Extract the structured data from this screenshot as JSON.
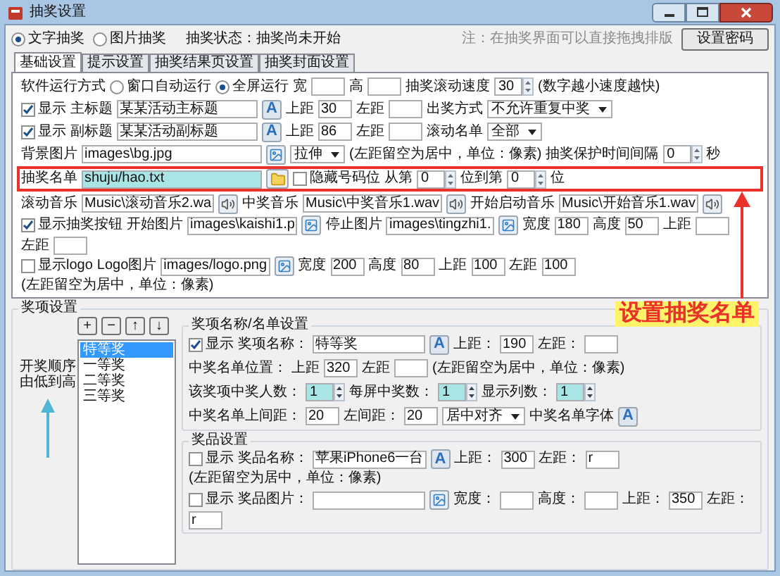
{
  "window": {
    "title": "抽奖设置"
  },
  "top": {
    "radios": [
      {
        "label": "文字抽奖",
        "selected": true
      },
      {
        "label": "图片抽奖",
        "selected": false
      }
    ],
    "status": "抽奖状态：抽奖尚未开始",
    "note": "注：在抽奖界面可以直接拖拽排版",
    "password_button": "设置密码"
  },
  "tabs": [
    {
      "label": "基础设置",
      "selected": true
    },
    {
      "label": "提示设置",
      "selected": false
    },
    {
      "label": "抽奖结果页设置",
      "selected": false
    },
    {
      "label": "抽奖封面设置",
      "selected": false
    }
  ],
  "basic": {
    "rows": [
      {
        "items": [
          {
            "kind": "label",
            "text": "软件运行方式"
          },
          {
            "kind": "radio",
            "label": "窗口自动运行",
            "selected": false
          },
          {
            "kind": "radio",
            "label": "全屏运行",
            "selected": true
          },
          {
            "kind": "label",
            "text": "宽"
          },
          {
            "kind": "field"
          },
          {
            "kind": "label",
            "text": "高"
          },
          {
            "kind": "field"
          },
          {
            "kind": "label",
            "text": "抽奖滚动速度"
          },
          {
            "kind": "spin",
            "value": "30"
          },
          {
            "kind": "note",
            "text": "(数字越小速度越快)"
          }
        ]
      },
      {
        "items": [
          {
            "kind": "checkbox",
            "label": "显示",
            "checked": true
          },
          {
            "kind": "label",
            "text": "主标题"
          },
          {
            "kind": "name_field",
            "value": "某某活动主标题"
          },
          {
            "kind": "font_button",
            "text": "A"
          },
          {
            "kind": "label",
            "text": "上距"
          },
          {
            "kind": "field",
            "value": "30"
          },
          {
            "kind": "label",
            "text": "左距"
          },
          {
            "kind": "field"
          },
          {
            "kind": "label",
            "text": "出奖方式"
          },
          {
            "kind": "select",
            "value": "不允许重复中奖"
          }
        ]
      },
      {
        "items": [
          {
            "kind": "checkbox",
            "label": "显示",
            "checked": true
          },
          {
            "kind": "label",
            "text": "副标题"
          },
          {
            "kind": "name_field",
            "value": "某某活动副标题"
          },
          {
            "kind": "font_button",
            "text": "A"
          },
          {
            "kind": "label",
            "text": "上距"
          },
          {
            "kind": "field",
            "value": "86"
          },
          {
            "kind": "label",
            "text": "左距"
          },
          {
            "kind": "field"
          },
          {
            "kind": "label",
            "text": "滚动名单"
          },
          {
            "kind": "select",
            "value": "全部"
          }
        ]
      },
      {
        "items": [
          {
            "kind": "label",
            "text": "背景图片"
          },
          {
            "kind": "long_field",
            "value": "images\\bg.jpg"
          },
          {
            "kind": "image_button"
          },
          {
            "kind": "select",
            "value": "拉伸"
          },
          {
            "kind": "note",
            "text": "(左距留空为居中，单位：像素)"
          },
          {
            "kind": "label",
            "text": "抽奖保护时间间隔"
          },
          {
            "kind": "spin",
            "value": "0"
          },
          {
            "kind": "label",
            "text": "秒"
          }
        ]
      },
      {
        "boxed": true,
        "items": [
          {
            "kind": "label",
            "text": "抽奖名单"
          },
          {
            "kind": "long_field",
            "value": "shuju/hao.txt",
            "highlighted": true
          },
          {
            "kind": "folder_button"
          },
          {
            "kind": "checkbox",
            "label": "隐藏号码位",
            "checked": false
          },
          {
            "kind": "label",
            "text": "从第"
          },
          {
            "kind": "spin",
            "value": "0"
          },
          {
            "kind": "label",
            "text": "位到第"
          },
          {
            "kind": "spin",
            "value": "0"
          },
          {
            "kind": "label",
            "text": "位"
          }
        ]
      },
      {
        "items": [
          {
            "kind": "label",
            "text": "滚动音乐"
          },
          {
            "kind": "path_field",
            "value": "Music\\滚动音乐2.wa"
          },
          {
            "kind": "speaker_button"
          },
          {
            "kind": "label",
            "text": "中奖音乐"
          },
          {
            "kind": "path_field",
            "value": "Music\\中奖音乐1.wav"
          },
          {
            "kind": "speaker_button"
          },
          {
            "kind": "label",
            "text": "开始启动音乐"
          },
          {
            "kind": "path_field",
            "value": "Music\\开始音乐1.wav"
          },
          {
            "kind": "speaker_button"
          }
        ]
      },
      {
        "items": [
          {
            "kind": "checkbox",
            "label": "显示抽奖按钮",
            "checked": true
          },
          {
            "kind": "label",
            "text": "开始图片"
          },
          {
            "kind": "path_field",
            "value": "images\\kaishi1.p"
          },
          {
            "kind": "image_button"
          },
          {
            "kind": "label",
            "text": "停止图片"
          },
          {
            "kind": "path_field",
            "value": "images\\tingzhi1."
          },
          {
            "kind": "image_button"
          },
          {
            "kind": "label",
            "text": "宽度"
          },
          {
            "kind": "field",
            "value": "180"
          },
          {
            "kind": "label",
            "text": "高度"
          },
          {
            "kind": "field",
            "value": "50"
          },
          {
            "kind": "label",
            "text": "上距"
          },
          {
            "kind": "field"
          },
          {
            "kind": "label",
            "text": "左距"
          },
          {
            "kind": "field"
          }
        ]
      },
      {
        "items": [
          {
            "kind": "checkbox",
            "label": "显示logo",
            "checked": false
          },
          {
            "kind": "label",
            "text": "Logo图片"
          },
          {
            "kind": "path_field",
            "value": "images/logo.png"
          },
          {
            "kind": "image_button"
          },
          {
            "kind": "label",
            "text": "宽度"
          },
          {
            "kind": "field",
            "value": "200"
          },
          {
            "kind": "label",
            "text": "高度"
          },
          {
            "kind": "field",
            "value": "80"
          },
          {
            "kind": "label",
            "text": "上距"
          },
          {
            "kind": "field",
            "value": "100"
          },
          {
            "kind": "label",
            "text": "左距"
          },
          {
            "kind": "field",
            "value": "100"
          },
          {
            "kind": "note",
            "text": "(左距留空为居中，单位：像素)"
          }
        ]
      }
    ]
  },
  "annotation": {
    "text": "设置抽奖名单"
  },
  "awards": {
    "title": "奖项设置",
    "buttons": [
      "+",
      "−",
      "↑",
      "↓"
    ],
    "order_label": "开奖顺序由低到高",
    "list": [
      {
        "label": "特等奖",
        "selected": true
      },
      {
        "label": "一等奖",
        "selected": false
      },
      {
        "label": "二等奖",
        "selected": false
      },
      {
        "label": "三等奖",
        "selected": false
      }
    ],
    "name_group": {
      "title": "奖项名称/名单设置",
      "rows": [
        {
          "items": [
            {
              "kind": "checkbox",
              "label": "显示",
              "checked": true
            },
            {
              "kind": "label",
              "text": "奖项名称："
            },
            {
              "kind": "text_field",
              "value": "特等奖"
            },
            {
              "kind": "font_button",
              "text": "A"
            },
            {
              "kind": "label",
              "text": "上距："
            },
            {
              "kind": "field",
              "value": "190"
            },
            {
              "kind": "label",
              "text": "左距："
            },
            {
              "kind": "field"
            }
          ]
        },
        {
          "items": [
            {
              "kind": "label",
              "text": "中奖名单位置："
            },
            {
              "kind": "label",
              "text": "上距"
            },
            {
              "kind": "field",
              "value": "320"
            },
            {
              "kind": "label",
              "text": "左距"
            },
            {
              "kind": "field"
            },
            {
              "kind": "note",
              "text": "(左距留空为居中，单位：像素)"
            }
          ]
        },
        {
          "items": [
            {
              "kind": "label",
              "text": "该奖项中奖人数："
            },
            {
              "kind": "spin",
              "value": "1",
              "highlighted": true
            },
            {
              "kind": "label",
              "text": "每屏中奖数："
            },
            {
              "kind": "spin",
              "value": "1",
              "highlighted": true
            },
            {
              "kind": "label",
              "text": "显示列数："
            },
            {
              "kind": "spin",
              "value": "1",
              "highlighted": true
            }
          ]
        },
        {
          "items": [
            {
              "kind": "label",
              "text": "中奖名单上间距："
            },
            {
              "kind": "field",
              "value": "20"
            },
            {
              "kind": "label",
              "text": "左间距："
            },
            {
              "kind": "field",
              "value": "20"
            },
            {
              "kind": "select",
              "value": "居中对齐"
            },
            {
              "kind": "label",
              "text": "中奖名单字体"
            },
            {
              "kind": "font_button",
              "text": "A"
            }
          ]
        }
      ]
    },
    "prize_group": {
      "title": "奖品设置",
      "rows": [
        {
          "items": [
            {
              "kind": "checkbox",
              "label": "显示",
              "checked": false
            },
            {
              "kind": "label",
              "text": "奖品名称："
            },
            {
              "kind": "text_field",
              "value": "苹果iPhone6一台"
            },
            {
              "kind": "font_button",
              "text": "A"
            },
            {
              "kind": "label",
              "text": "上距："
            },
            {
              "kind": "field",
              "value": "300"
            },
            {
              "kind": "label",
              "text": "左距："
            },
            {
              "kind": "field",
              "value": "r"
            },
            {
              "kind": "note",
              "text": "(左距留空为居中，单位：像素)"
            }
          ]
        },
        {
          "items": [
            {
              "kind": "checkbox",
              "label": "显示",
              "checked": false
            },
            {
              "kind": "label",
              "text": "奖品图片："
            },
            {
              "kind": "text_field"
            },
            {
              "kind": "image_button"
            },
            {
              "kind": "label",
              "text": "宽度："
            },
            {
              "kind": "field"
            },
            {
              "kind": "label",
              "text": "高度："
            },
            {
              "kind": "field"
            },
            {
              "kind": "label",
              "text": "上距："
            },
            {
              "kind": "field",
              "value": "350"
            },
            {
              "kind": "label",
              "text": "左距："
            },
            {
              "kind": "field",
              "value": "r"
            }
          ]
        }
      ]
    }
  }
}
